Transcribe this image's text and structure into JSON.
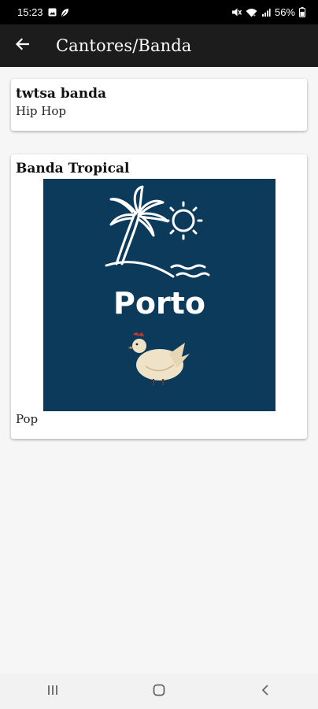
{
  "status_bar": {
    "time": "15:23",
    "battery": "56%",
    "icons": [
      "gallery-icon",
      "leaf-icon",
      "mute-icon",
      "wifi-icon",
      "signal-icon",
      "battery-icon"
    ]
  },
  "app_bar": {
    "title": "Cantores/Banda",
    "back_icon": "arrow-back-icon"
  },
  "bands": [
    {
      "name": "twtsa banda",
      "genre": "Hip Hop"
    },
    {
      "name": "Banda Tropical",
      "genre": "Pop",
      "image_text": "Porto"
    }
  ],
  "nav_bar": {
    "icons": [
      "recents-icon",
      "home-icon",
      "back-icon"
    ]
  },
  "colors": {
    "app_bar": "#1c1c1c",
    "image_bg": "#0b3a5a",
    "page_bg": "#f6f6f6"
  }
}
